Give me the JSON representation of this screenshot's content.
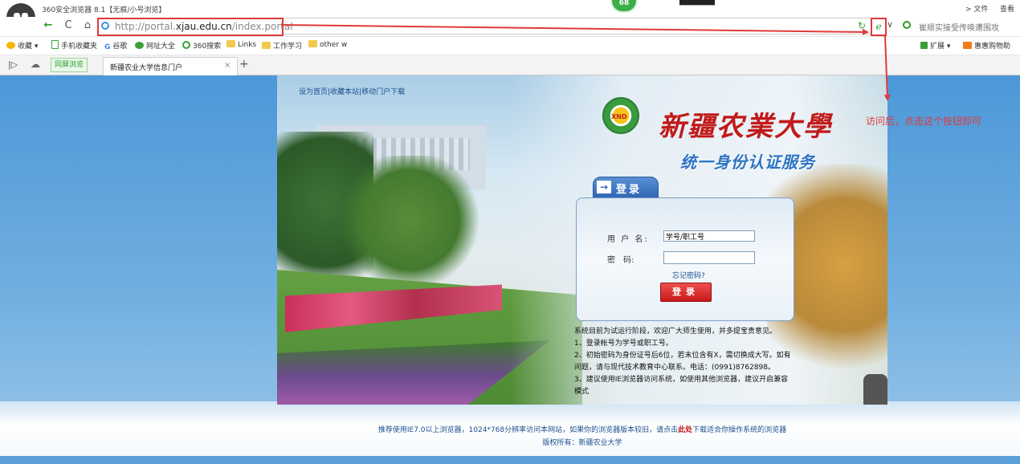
{
  "browser": {
    "window_title": "360安全浏览器 8.1【无痕/小号浏览】",
    "badge": "68",
    "menu_file": "> 文件",
    "menu_view": "查看",
    "url_prefix": "http://portal.",
    "url_host": "xjau.edu.cn",
    "url_path": "/index.portal",
    "search_text": "崔顺实接受传唤遭围攻",
    "bookmarks": [
      "收藏",
      "手机收藏夹",
      "谷歌",
      "网址大全",
      "360搜索",
      "Links",
      "工作学习",
      "other w"
    ],
    "bookmarks_right": [
      "扩展",
      "惠惠购物助"
    ],
    "tab_split": "同屏浏览",
    "tab_title": "新疆农业大学信息门户"
  },
  "page": {
    "top_links": "设为首页|收藏本站|移动门户下载",
    "emblem_label": "XND",
    "university_name": "新疆农業大學",
    "auth_title": "统一身份认证服务",
    "login_tab": "登录",
    "username_label": "用 户 名:",
    "username_value": "学号/职工号",
    "password_label": "密　码:",
    "forgot_password": "忘记密码?",
    "login_button": "登录",
    "notice": [
      "系统目前为试运行阶段，欢迎广大师生使用，并多提宝贵意见。",
      "1、登录帐号为学号或职工号。",
      "2、初始密码为身份证号后6位，若末位含有X，需切换成大写。如有问题，请与现代技术教育中心联系。电话：(0991)8762898。",
      "3、建议使用IE浏览器访问系统，如使用其他浏览器，建议开启兼容模式"
    ],
    "footer_line1_a": "推荐使用IE7.0以上浏览器，1024*768分辨率访问本网站，如果你的浏览器版本较旧，请点击",
    "footer_here": "此处",
    "footer_line1_b": "下载适合你操作系统的浏览器",
    "footer_line2": "版权所有：新疆农业大学"
  },
  "annotation": {
    "text": "访问后，点击这个按钮即可",
    "color": "#e03a3a"
  }
}
